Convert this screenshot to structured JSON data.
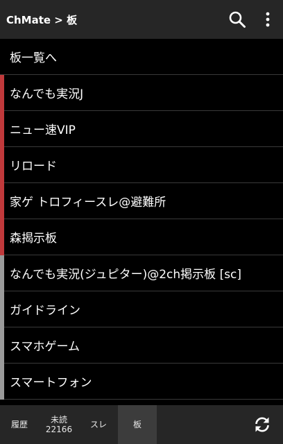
{
  "header": {
    "title": "ChMate > 板"
  },
  "list": {
    "items": [
      {
        "label": "板一覧へ",
        "marker": ""
      },
      {
        "label": "なんでも実況J",
        "marker": "#c0393b"
      },
      {
        "label": "ニュー速VIP",
        "marker": "#c0393b"
      },
      {
        "label": "リロード",
        "marker": "#c0393b"
      },
      {
        "label": "家ゲ トロフィースレ@避難所",
        "marker": "#c0393b"
      },
      {
        "label": "森揭示板",
        "marker": "#c0393b"
      },
      {
        "label": "なんでも実況(ジュピター)@2ch掲示板 [sc]",
        "marker": "#9a9a9a"
      },
      {
        "label": "ガイドライン",
        "marker": "#9a9a9a"
      },
      {
        "label": "スマホゲーム",
        "marker": "#9a9a9a"
      },
      {
        "label": "スマートフォン",
        "marker": "#9a9a9a"
      }
    ]
  },
  "bottom": {
    "history_label": "履歴",
    "unread_label": "未読",
    "unread_count": "22166",
    "thread_label": "スレ",
    "board_label": "板"
  },
  "icons": {
    "search": "search-icon",
    "more": "more-vert-icon",
    "refresh": "refresh-icon"
  },
  "colors": {
    "bar_bg": "#262626",
    "list_bg": "#000000",
    "marker_red": "#c0393b",
    "marker_gray": "#9a9a9a",
    "active_tab": "#3c3c3c"
  }
}
